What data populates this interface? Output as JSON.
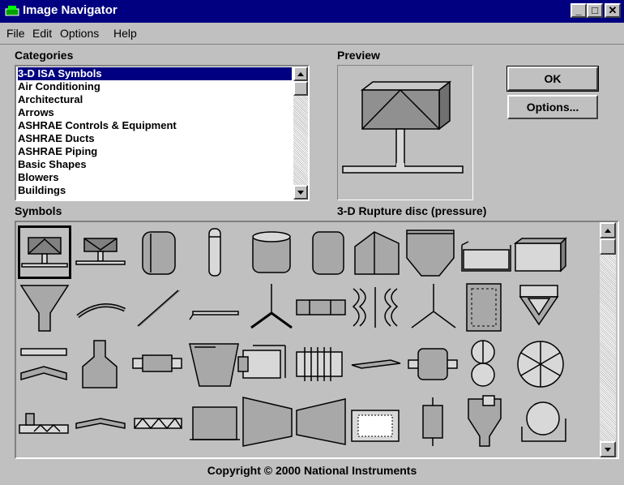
{
  "window": {
    "title": "Image Navigator",
    "minimize": "_",
    "maximize": "□",
    "close": "✕"
  },
  "menu": {
    "items": [
      "File",
      "Edit",
      "Options",
      "Help"
    ]
  },
  "categories": {
    "label": "Categories",
    "items": [
      "3-D ISA Symbols",
      "Air Conditioning",
      "Architectural",
      "Arrows",
      "ASHRAE Controls & Equipment",
      "ASHRAE Ducts",
      "ASHRAE Piping",
      "Basic Shapes",
      "Blowers",
      "Buildings"
    ],
    "selected": "3-D ISA Symbols"
  },
  "preview": {
    "label": "Preview",
    "caption": "3-D Rupture disc (pressure)"
  },
  "buttons": {
    "ok": "OK",
    "options": "Options..."
  },
  "symbols": {
    "label": "Symbols"
  },
  "footer": {
    "copyright": "Copyright © 2000 National Instruments"
  },
  "colors": {
    "titlebar": "#000080",
    "face": "#c0c0c0",
    "selection": "#000080",
    "shape_fill": "#a8a8a8"
  }
}
